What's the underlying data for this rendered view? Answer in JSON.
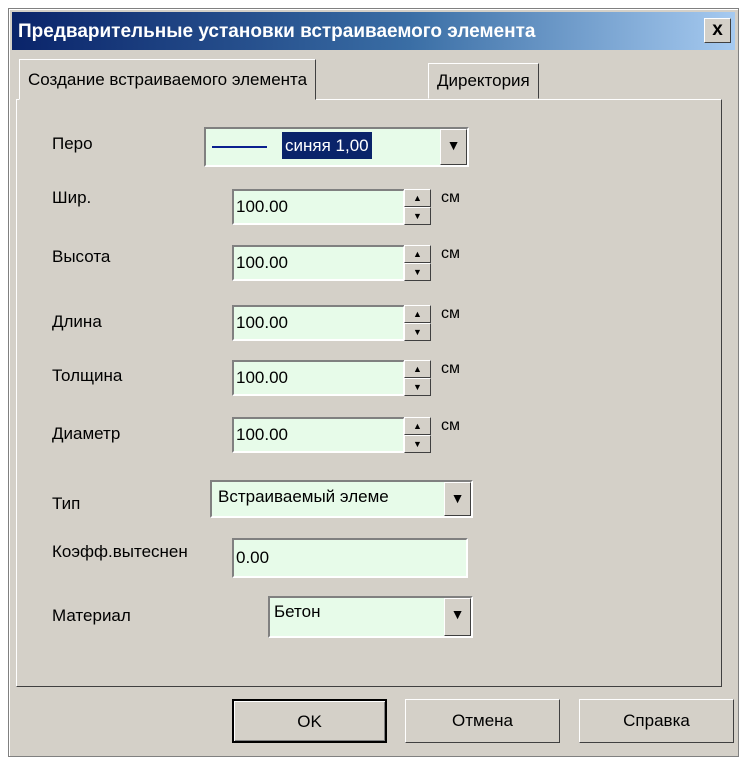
{
  "window": {
    "title": "Предварительные установки встраиваемого элемента",
    "close": "x"
  },
  "tabs": [
    {
      "label": "Создание встраиваемого элемента"
    },
    {
      "label": "Директория"
    }
  ],
  "form": {
    "pen": {
      "label": "Перо",
      "value": "синяя 1,00",
      "line_color": "#0b1f8f"
    },
    "width": {
      "label": "Шир.",
      "value": "100.00",
      "unit": "см"
    },
    "height": {
      "label": "Высота",
      "value": "100.00",
      "unit": "см"
    },
    "length": {
      "label": "Длина",
      "value": "100.00",
      "unit": "см"
    },
    "thickness": {
      "label": "Толщина",
      "value": "100.00",
      "unit": "см"
    },
    "diameter": {
      "label": "Диаметр",
      "value": "100.00",
      "unit": "см"
    },
    "type": {
      "label": "Тип",
      "value": "Встраиваемый элеме"
    },
    "coef": {
      "label": "Коэфф.вытеснен",
      "value": "0.00"
    },
    "material": {
      "label": "Материал",
      "value": "Бетон"
    }
  },
  "buttons": {
    "ok": "OK",
    "cancel": "Отмена",
    "help": "Справка"
  },
  "colors": {
    "field_bg": "#e7fbe9",
    "dialog_bg": "#d4d0c8",
    "title_bg": "#0a246a",
    "selection": "#0a246a"
  }
}
